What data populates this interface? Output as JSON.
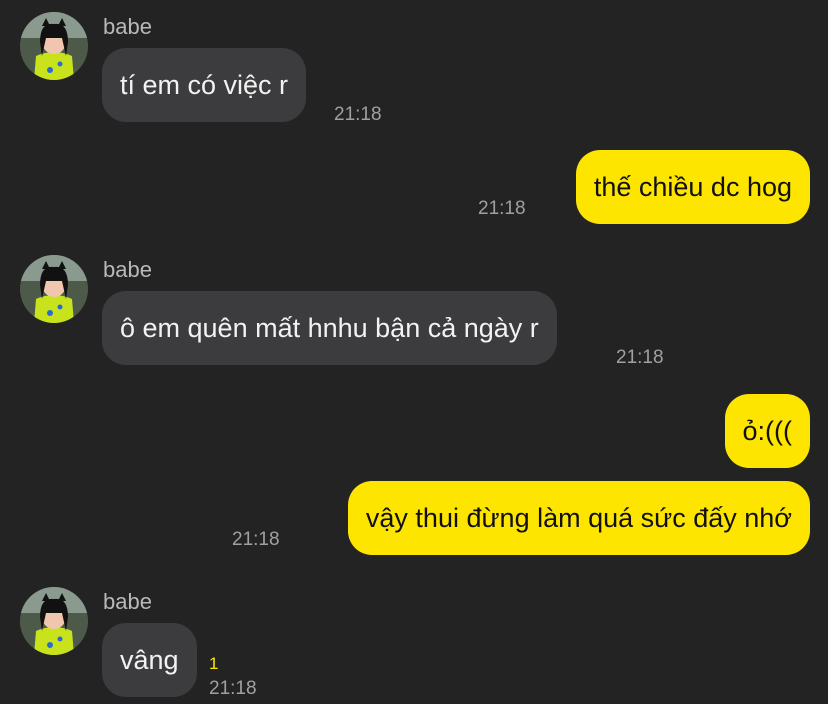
{
  "theme": {
    "background": "#232323",
    "incoming_bubble": "#3c3c3e",
    "outgoing_bubble": "#fde500",
    "unread_color": "#fde500"
  },
  "messages": [
    {
      "direction": "incoming",
      "sender": "babe",
      "text": "tí em có việc r",
      "time": "21:18"
    },
    {
      "direction": "outgoing",
      "text": "thế chiều dc hog",
      "time": "21:18"
    },
    {
      "direction": "incoming",
      "sender": "babe",
      "text": "ô em quên mất hnhu bận cả ngày r",
      "time": "21:18"
    },
    {
      "direction": "outgoing",
      "text": "ỏ:(((",
      "time": ""
    },
    {
      "direction": "outgoing",
      "text": "vậy thui đừng làm quá sức đấy nhớ",
      "time": "21:18"
    },
    {
      "direction": "incoming",
      "sender": "babe",
      "text": "vâng",
      "time": "21:18",
      "unread": "1"
    }
  ]
}
